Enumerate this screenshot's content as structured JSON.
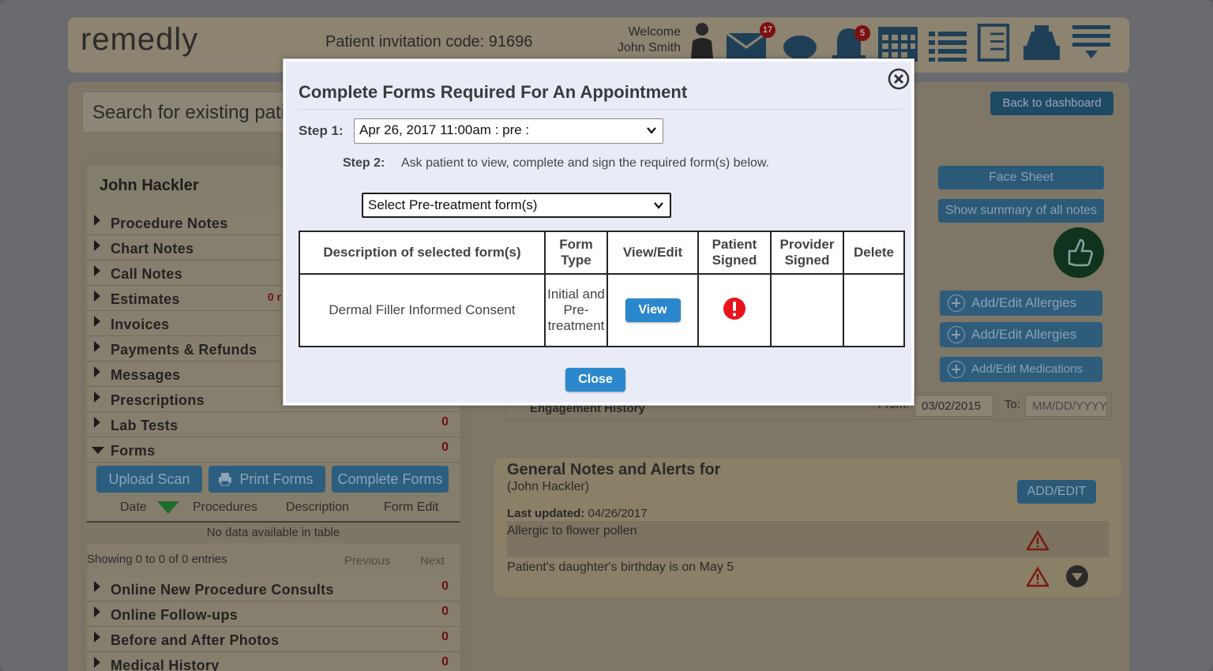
{
  "header": {
    "logo": "remedly",
    "invitation": "Patient invitation code: 91696",
    "welcome_line1": "Welcome",
    "welcome_line2": "John Smith",
    "mail_badge": "17",
    "bell_badge": "5"
  },
  "search": {
    "placeholder": "Search for existing patie"
  },
  "back_to_dashboard": "Back to dashboard",
  "patient": {
    "name": "John Hackler"
  },
  "nav": [
    {
      "label": "Procedure Notes",
      "count": ""
    },
    {
      "label": "Chart Notes",
      "count": ""
    },
    {
      "label": "Call Notes",
      "count": ""
    },
    {
      "label": "Estimates",
      "count": "0 r"
    },
    {
      "label": "Invoices",
      "count": ""
    },
    {
      "label": "Payments & Refunds",
      "count": ""
    },
    {
      "label": "Messages",
      "count": ""
    },
    {
      "label": "Prescriptions",
      "count": ""
    },
    {
      "label": "Lab Tests",
      "count": "0"
    },
    {
      "label": "Forms",
      "count": "0"
    }
  ],
  "forms_section": {
    "upload_scan": "Upload Scan",
    "print_forms": "Print Forms",
    "complete_forms": "Complete Forms",
    "col_date": "Date",
    "col_procedures": "Procedures",
    "col_description": "Description",
    "col_form_edit": "Form Edit",
    "no_data": "No data available in table",
    "showing": "Showing 0 to 0 of 0 entries",
    "previous": "Previous",
    "next": "Next"
  },
  "nav2": [
    {
      "label": "Online New Procedure Consults",
      "count": "0"
    },
    {
      "label": "Online Follow-ups",
      "count": "0"
    },
    {
      "label": "Before and After Photos",
      "count": "0"
    },
    {
      "label": "Medical History",
      "count": "0"
    }
  ],
  "right": {
    "face_sheet": "Face Sheet",
    "show_summary": "Show summary of all notes",
    "add_allergies_1": "Add/Edit Allergies",
    "add_allergies_2": "Add/Edit Allergies",
    "add_medications": "Add/Edit Medications",
    "engagement": "Engagement History",
    "from_label": "From:",
    "from_value": "03/02/2015",
    "to_label": "To:",
    "to_placeholder": "MM/DD/YYYY"
  },
  "notes": {
    "title": "General Notes and Alerts for",
    "subtitle": "(John Hackler)",
    "add_edit": "ADD/EDIT",
    "last_updated_label": "Last updated:",
    "last_updated_value": "04/26/2017",
    "items": [
      "Allergic to flower pollen",
      "Patient's daughter's birthday is on May 5"
    ]
  },
  "modal": {
    "title": "Complete Forms Required For An Appointment",
    "step1_label": "Step 1:",
    "step1_value": "Apr 26, 2017 11:00am : pre :",
    "step2_label": "Step 2:",
    "step2_text": "Ask patient to view, complete and sign the required form(s) below.",
    "pretreatment_select": "Select Pre-treatment form(s)",
    "table": {
      "headers": {
        "description": "Description of selected form(s)",
        "form_type": "Form Type",
        "view_edit": "View/Edit",
        "patient_signed": "Patient Signed",
        "provider_signed": "Provider Signed",
        "delete": "Delete"
      },
      "rows": [
        {
          "description": "Dermal Filler Informed Consent",
          "form_type": "Initial and Pre-treatment",
          "view_label": "View",
          "patient_signed_icon": "alert-icon",
          "provider_signed": "",
          "delete": ""
        }
      ]
    },
    "close_label": "Close",
    "accent_color": "#2c88cc",
    "alert_color": "#e8141c"
  }
}
